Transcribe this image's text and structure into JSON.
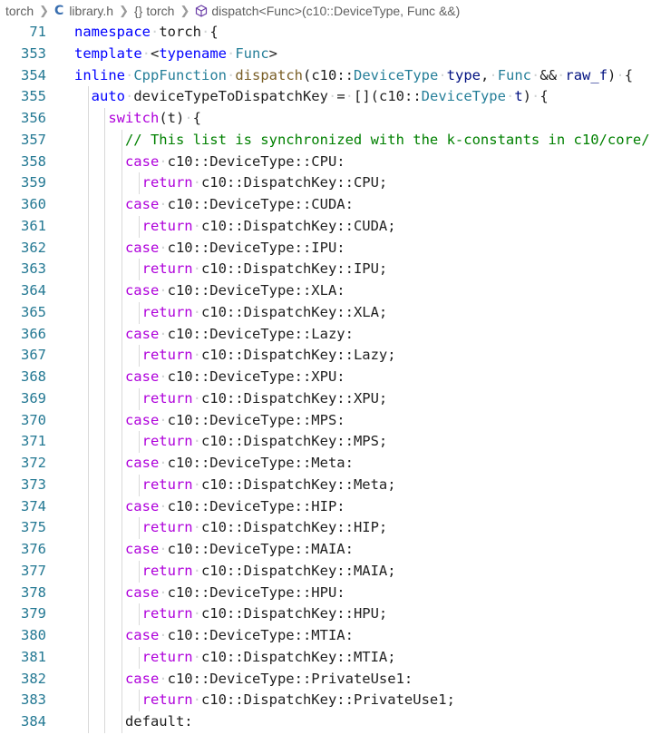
{
  "breadcrumb": {
    "items": [
      "torch",
      "library.h",
      "torch",
      "dispatch<Func>(c10::DeviceType, Func &&)"
    ]
  },
  "lines": [
    {
      "n": "71",
      "ind": 0,
      "tokens": [
        [
          "kw",
          "namespace"
        ],
        [
          "",
          "torch"
        ],
        [
          "",
          "{"
        ]
      ]
    },
    {
      "n": "353",
      "ind": 0,
      "tokens": [
        [
          "kw",
          "template"
        ],
        [
          "",
          "<"
        ],
        [
          "kw",
          "typename"
        ],
        [
          "ty",
          "Func"
        ],
        [
          "",
          ">"
        ]
      ]
    },
    {
      "n": "354",
      "ind": 0,
      "tokens": [
        [
          "kw",
          "inline"
        ],
        [
          "ty",
          "CppFunction"
        ],
        [
          "fn",
          "dispatch"
        ],
        [
          "",
          "(c10::"
        ],
        [
          "ty",
          "DeviceType"
        ],
        [
          "pm",
          "type"
        ],
        [
          "",
          ","
        ],
        [
          "ty",
          "Func"
        ],
        [
          "",
          "&&"
        ],
        [
          "pm",
          "raw_f"
        ],
        [
          "",
          ")"
        ],
        [
          "",
          "{"
        ]
      ]
    },
    {
      "n": "355",
      "ind": 1,
      "tokens": [
        [
          "kw",
          "auto"
        ],
        [
          "",
          "deviceTypeToDispatchKey"
        ],
        [
          "",
          "="
        ],
        [
          "",
          "[](c10::"
        ],
        [
          "ty",
          "DeviceType"
        ],
        [
          "pm",
          "t"
        ],
        [
          "",
          ")"
        ],
        [
          "",
          "{"
        ]
      ]
    },
    {
      "n": "356",
      "ind": 2,
      "tokens": [
        [
          "br",
          "switch"
        ],
        [
          "",
          "(t)"
        ],
        [
          "",
          "{"
        ]
      ]
    },
    {
      "n": "357",
      "ind": 3,
      "tokens": [
        [
          "cm",
          "// This list is synchronized with the k-constants in c10/core/"
        ]
      ]
    },
    {
      "n": "358",
      "ind": 3,
      "tokens": [
        [
          "br",
          "case"
        ],
        [
          "",
          "c10::DeviceType::CPU:"
        ]
      ]
    },
    {
      "n": "359",
      "ind": 4,
      "tokens": [
        [
          "br",
          "return"
        ],
        [
          "",
          "c10::DispatchKey::CPU;"
        ]
      ]
    },
    {
      "n": "360",
      "ind": 3,
      "tokens": [
        [
          "br",
          "case"
        ],
        [
          "",
          "c10::DeviceType::CUDA:"
        ]
      ]
    },
    {
      "n": "361",
      "ind": 4,
      "tokens": [
        [
          "br",
          "return"
        ],
        [
          "",
          "c10::DispatchKey::CUDA;"
        ]
      ]
    },
    {
      "n": "362",
      "ind": 3,
      "tokens": [
        [
          "br",
          "case"
        ],
        [
          "",
          "c10::DeviceType::IPU:"
        ]
      ]
    },
    {
      "n": "363",
      "ind": 4,
      "tokens": [
        [
          "br",
          "return"
        ],
        [
          "",
          "c10::DispatchKey::IPU;"
        ]
      ]
    },
    {
      "n": "364",
      "ind": 3,
      "tokens": [
        [
          "br",
          "case"
        ],
        [
          "",
          "c10::DeviceType::XLA:"
        ]
      ]
    },
    {
      "n": "365",
      "ind": 4,
      "tokens": [
        [
          "br",
          "return"
        ],
        [
          "",
          "c10::DispatchKey::XLA;"
        ]
      ]
    },
    {
      "n": "366",
      "ind": 3,
      "tokens": [
        [
          "br",
          "case"
        ],
        [
          "",
          "c10::DeviceType::Lazy:"
        ]
      ]
    },
    {
      "n": "367",
      "ind": 4,
      "tokens": [
        [
          "br",
          "return"
        ],
        [
          "",
          "c10::DispatchKey::Lazy;"
        ]
      ]
    },
    {
      "n": "368",
      "ind": 3,
      "tokens": [
        [
          "br",
          "case"
        ],
        [
          "",
          "c10::DeviceType::XPU:"
        ]
      ]
    },
    {
      "n": "369",
      "ind": 4,
      "tokens": [
        [
          "br",
          "return"
        ],
        [
          "",
          "c10::DispatchKey::XPU;"
        ]
      ]
    },
    {
      "n": "370",
      "ind": 3,
      "tokens": [
        [
          "br",
          "case"
        ],
        [
          "",
          "c10::DeviceType::MPS:"
        ]
      ]
    },
    {
      "n": "371",
      "ind": 4,
      "tokens": [
        [
          "br",
          "return"
        ],
        [
          "",
          "c10::DispatchKey::MPS;"
        ]
      ]
    },
    {
      "n": "372",
      "ind": 3,
      "tokens": [
        [
          "br",
          "case"
        ],
        [
          "",
          "c10::DeviceType::Meta:"
        ]
      ]
    },
    {
      "n": "373",
      "ind": 4,
      "tokens": [
        [
          "br",
          "return"
        ],
        [
          "",
          "c10::DispatchKey::Meta;"
        ]
      ]
    },
    {
      "n": "374",
      "ind": 3,
      "tokens": [
        [
          "br",
          "case"
        ],
        [
          "",
          "c10::DeviceType::HIP:"
        ]
      ]
    },
    {
      "n": "375",
      "ind": 4,
      "tokens": [
        [
          "br",
          "return"
        ],
        [
          "",
          "c10::DispatchKey::HIP;"
        ]
      ]
    },
    {
      "n": "376",
      "ind": 3,
      "tokens": [
        [
          "br",
          "case"
        ],
        [
          "",
          "c10::DeviceType::MAIA:"
        ]
      ]
    },
    {
      "n": "377",
      "ind": 4,
      "tokens": [
        [
          "br",
          "return"
        ],
        [
          "",
          "c10::DispatchKey::MAIA;"
        ]
      ]
    },
    {
      "n": "378",
      "ind": 3,
      "tokens": [
        [
          "br",
          "case"
        ],
        [
          "",
          "c10::DeviceType::HPU:"
        ]
      ]
    },
    {
      "n": "379",
      "ind": 4,
      "tokens": [
        [
          "br",
          "return"
        ],
        [
          "",
          "c10::DispatchKey::HPU;"
        ]
      ]
    },
    {
      "n": "380",
      "ind": 3,
      "tokens": [
        [
          "br",
          "case"
        ],
        [
          "",
          "c10::DeviceType::MTIA:"
        ]
      ]
    },
    {
      "n": "381",
      "ind": 4,
      "tokens": [
        [
          "br",
          "return"
        ],
        [
          "",
          "c10::DispatchKey::MTIA;"
        ]
      ]
    },
    {
      "n": "382",
      "ind": 3,
      "tokens": [
        [
          "br",
          "case"
        ],
        [
          "",
          "c10::DeviceType::PrivateUse1:"
        ]
      ]
    },
    {
      "n": "383",
      "ind": 4,
      "tokens": [
        [
          "br",
          "return"
        ],
        [
          "",
          "c10::DispatchKey::PrivateUse1;"
        ]
      ]
    },
    {
      "n": "384",
      "ind": 3,
      "tokens": [
        [
          "",
          "default:"
        ]
      ]
    }
  ]
}
